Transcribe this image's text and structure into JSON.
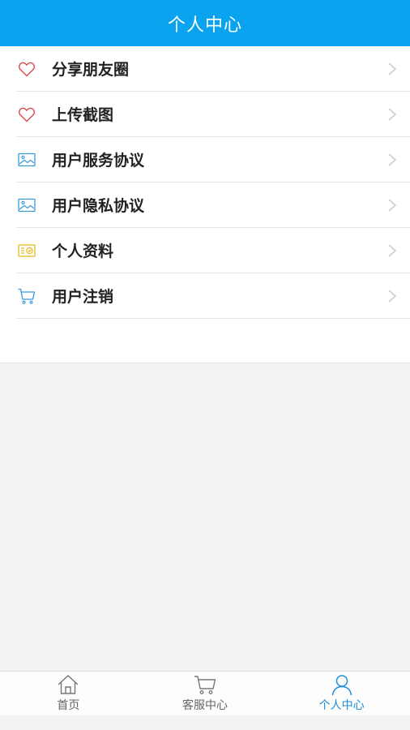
{
  "header": {
    "title": "个人中心"
  },
  "menu": {
    "items": [
      {
        "label": "分享朋友圈",
        "icon": "heart-icon"
      },
      {
        "label": "上传截图",
        "icon": "heart-icon"
      },
      {
        "label": "用户服务协议",
        "icon": "image-icon"
      },
      {
        "label": "用户隐私协议",
        "icon": "image-icon"
      },
      {
        "label": "个人资料",
        "icon": "id-card-icon"
      },
      {
        "label": "用户注销",
        "icon": "cart-icon"
      }
    ]
  },
  "tabbar": {
    "tabs": [
      {
        "label": "首页",
        "icon": "home-icon",
        "active": false
      },
      {
        "label": "客服中心",
        "icon": "cart-icon",
        "active": false
      },
      {
        "label": "个人中心",
        "icon": "user-icon",
        "active": true
      }
    ]
  },
  "colors": {
    "header_bg": "#0aa3ef",
    "heart": "#e0474c",
    "image": "#3a9ad9",
    "id_card": "#e8b91c",
    "cart": "#3a9ad9",
    "tab_active": "#1a8fd6"
  }
}
